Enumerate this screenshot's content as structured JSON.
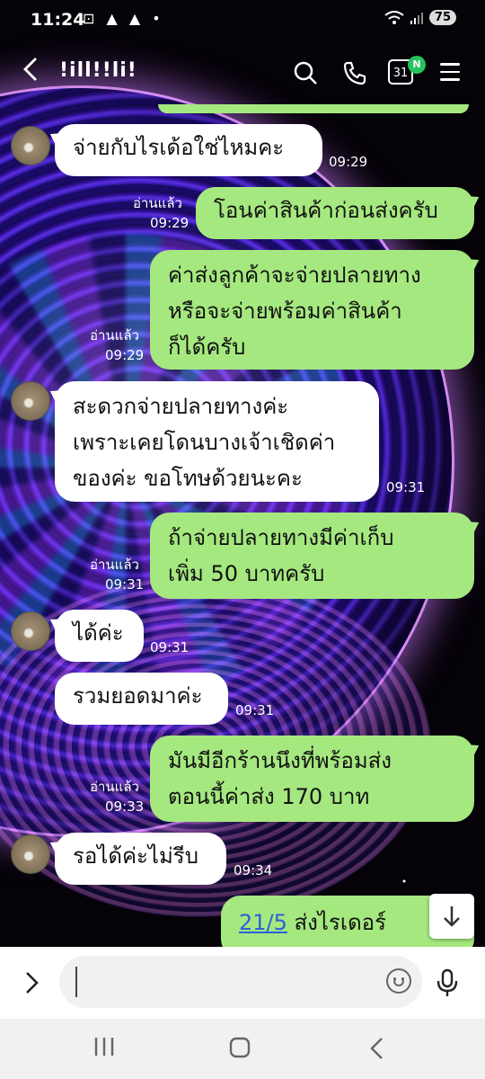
{
  "status_bar": {
    "time": "11:24",
    "icons": "⊡ ▲ ▲ •",
    "battery": "75"
  },
  "header": {
    "title": "!ill!!li!",
    "calendar_day": "31",
    "calendar_badge": "N",
    "icons": [
      "back-icon",
      "search-icon",
      "phone-icon",
      "calendar-icon",
      "menu-icon"
    ]
  },
  "messages": [
    {
      "side": "in",
      "text": "จ่ายกับไรเด้อใช่ไหมคะ",
      "time": "09:29"
    },
    {
      "side": "out",
      "text": "โอนค่าสินค้าก่อนส่งครับ",
      "read": "อ่านแล้ว",
      "time": "09:29"
    },
    {
      "side": "out",
      "lines": [
        "ค่าส่งลูกค้าจะจ่ายปลายทาง",
        "หรือจะจ่ายพร้อมค่าสินค้า",
        "ก็ได้ครับ"
      ],
      "read": "อ่านแล้ว",
      "time": "09:29"
    },
    {
      "side": "in",
      "lines": [
        "สะดวกจ่ายปลายทางค่ะ",
        "เพราะเคยโดนบางเจ้าเชิดค่า",
        "ของค่ะ ขอโทษด้วยนะคะ"
      ],
      "time": "09:31"
    },
    {
      "side": "out",
      "lines": [
        "ถ้าจ่ายปลายทางมีค่าเก็บ",
        "เพิ่ม 50 บาทครับ"
      ],
      "read": "อ่านแล้ว",
      "time": "09:31"
    },
    {
      "side": "in",
      "text": "ได้ค่ะ",
      "time": "09:31"
    },
    {
      "side": "in",
      "text": "รวมยอดมาค่ะ",
      "time": "09:31"
    },
    {
      "side": "out",
      "lines": [
        "มันมีอีกร้านนึงที่พร้อมส่ง",
        "ตอนนี้ค่าส่ง 170 บาท"
      ],
      "read": "อ่านแล้ว",
      "time": "09:33"
    },
    {
      "side": "in",
      "text": "รอได้ค่ะไม่รีบ",
      "time": "09:34"
    },
    {
      "side": "out",
      "link": "21/5",
      "text": " ส่งไรเดอร์"
    }
  ],
  "input": {
    "placeholder": ""
  },
  "colors": {
    "outgoing": "#a5e87f",
    "incoming": "#ffffff",
    "read_text": "#ffffff",
    "badge": "#25c35e"
  }
}
